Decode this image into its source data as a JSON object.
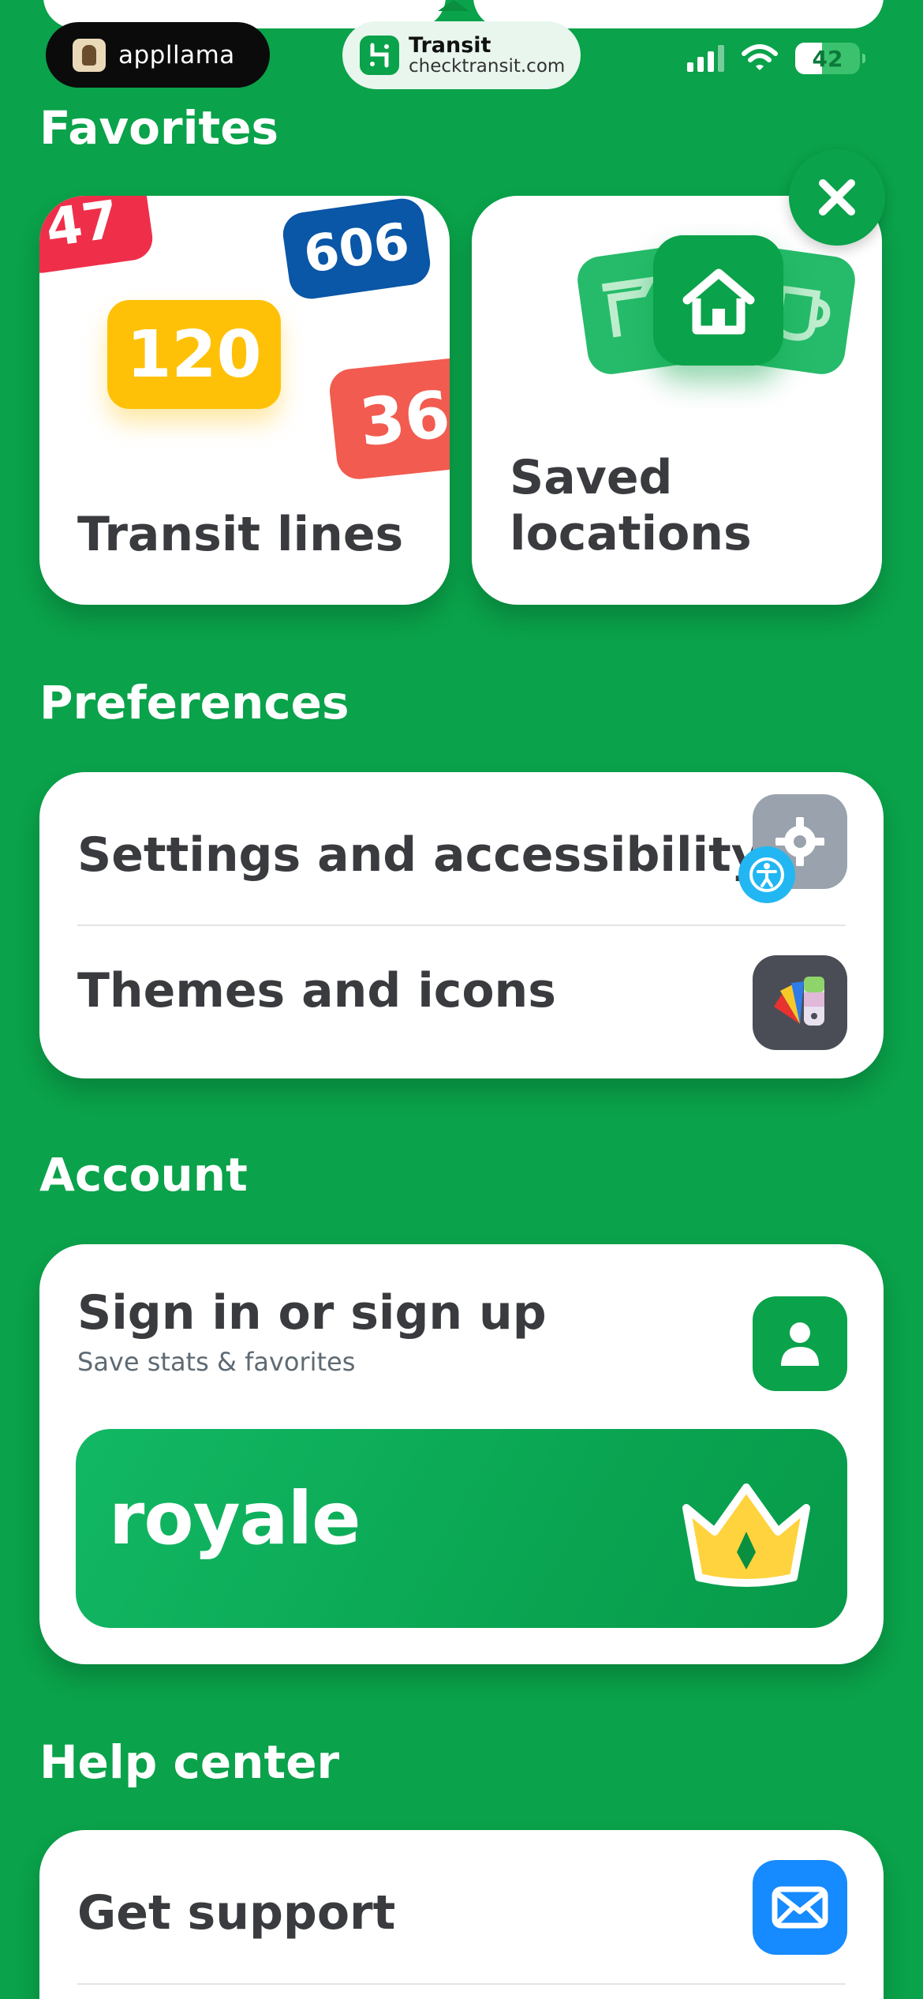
{
  "status_bar": {
    "applama_label": "appllama",
    "transit_name": "Transit",
    "transit_url": "checktransit.com",
    "battery": "42"
  },
  "favorites": {
    "title": "Favorites",
    "transit_lines": {
      "label": "Transit lines",
      "badges": [
        "47",
        "606",
        "120",
        "36"
      ]
    },
    "saved_locations": {
      "label_line1": "Saved",
      "label_line2": "locations"
    }
  },
  "preferences": {
    "title": "Preferences",
    "settings_label": "Settings and accessibility",
    "themes_label": "Themes and icons"
  },
  "account": {
    "title": "Account",
    "signin_label": "Sign in or sign up",
    "signin_sub": "Save stats & favorites",
    "royale_label": "royale"
  },
  "help": {
    "title": "Help center",
    "support_label": "Get support"
  },
  "colors": {
    "brand_green": "#0aa24a",
    "red": "#ef2f4a",
    "blue": "#0a56a7",
    "yellow": "#ffc107",
    "coral": "#f25b4f",
    "mail_blue": "#168aff"
  }
}
